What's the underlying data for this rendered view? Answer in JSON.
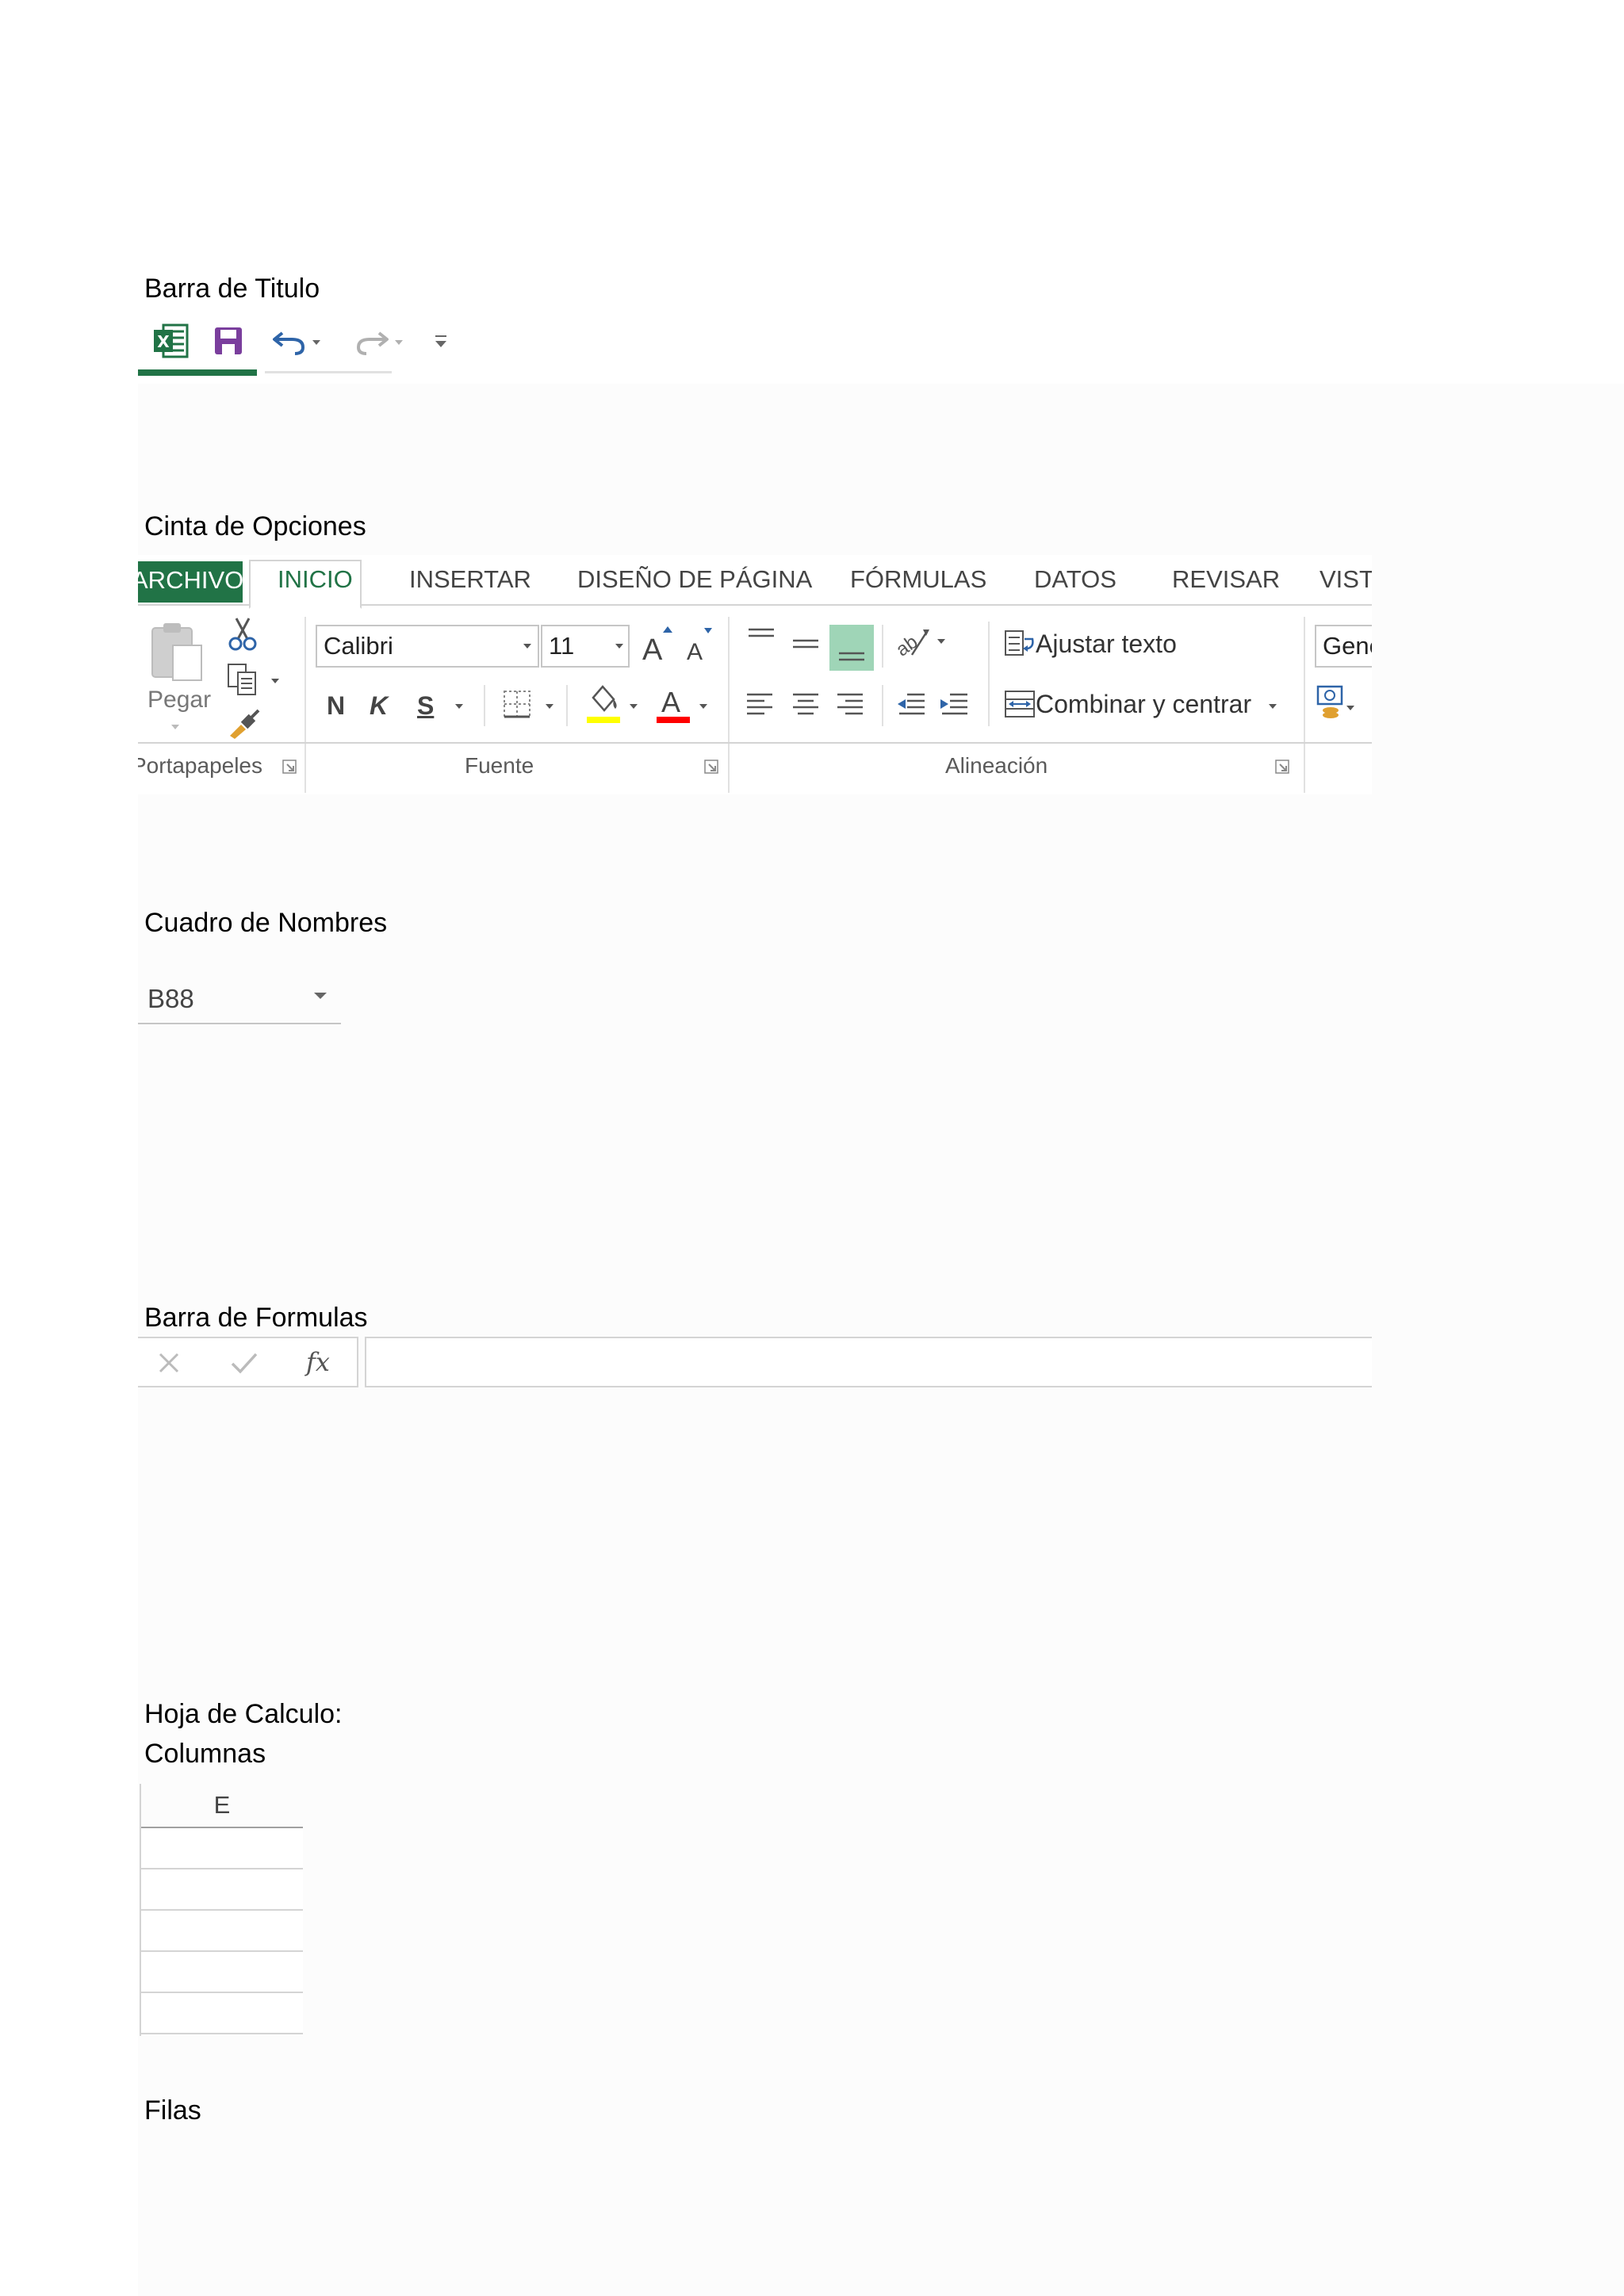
{
  "headings": {
    "title_bar": "Barra de Titulo",
    "ribbon": "Cinta de Opciones",
    "name_box": "Cuadro de Nombres",
    "formula_bar": "Barra de Formulas",
    "sheet_line1": "Hoja de Calculo:",
    "sheet_line2": "Columnas",
    "rows": "Filas"
  },
  "quick_access": {
    "icons": [
      "excel-icon",
      "save-icon",
      "undo-icon",
      "redo-icon",
      "customize-icon"
    ]
  },
  "ribbon": {
    "tabs": [
      "ARCHIVO",
      "INICIO",
      "INSERTAR",
      "DISEÑO DE PÁGINA",
      "FÓRMULAS",
      "DATOS",
      "REVISAR",
      "VISTA"
    ],
    "active_tab": "INICIO",
    "clipboard": {
      "paste_label": "Pegar",
      "group_label": "Portapapeles"
    },
    "font": {
      "font_name": "Calibri",
      "font_size": "11",
      "bold": "N",
      "italic": "K",
      "underline": "S",
      "group_label": "Fuente",
      "fill_color": "#ffff00",
      "font_color": "#ff0000"
    },
    "alignment": {
      "wrap_text": "Ajustar texto",
      "merge_center": "Combinar y centrar",
      "group_label": "Alineación"
    },
    "number": {
      "format": "General"
    }
  },
  "name_box": {
    "value": "B88"
  },
  "formula_bar": {
    "fx": "fx",
    "value": ""
  },
  "sheet": {
    "column_header": "E",
    "visible_rows": 5
  },
  "colors": {
    "accent": "#217346",
    "active_align": "#9fd5b7"
  }
}
